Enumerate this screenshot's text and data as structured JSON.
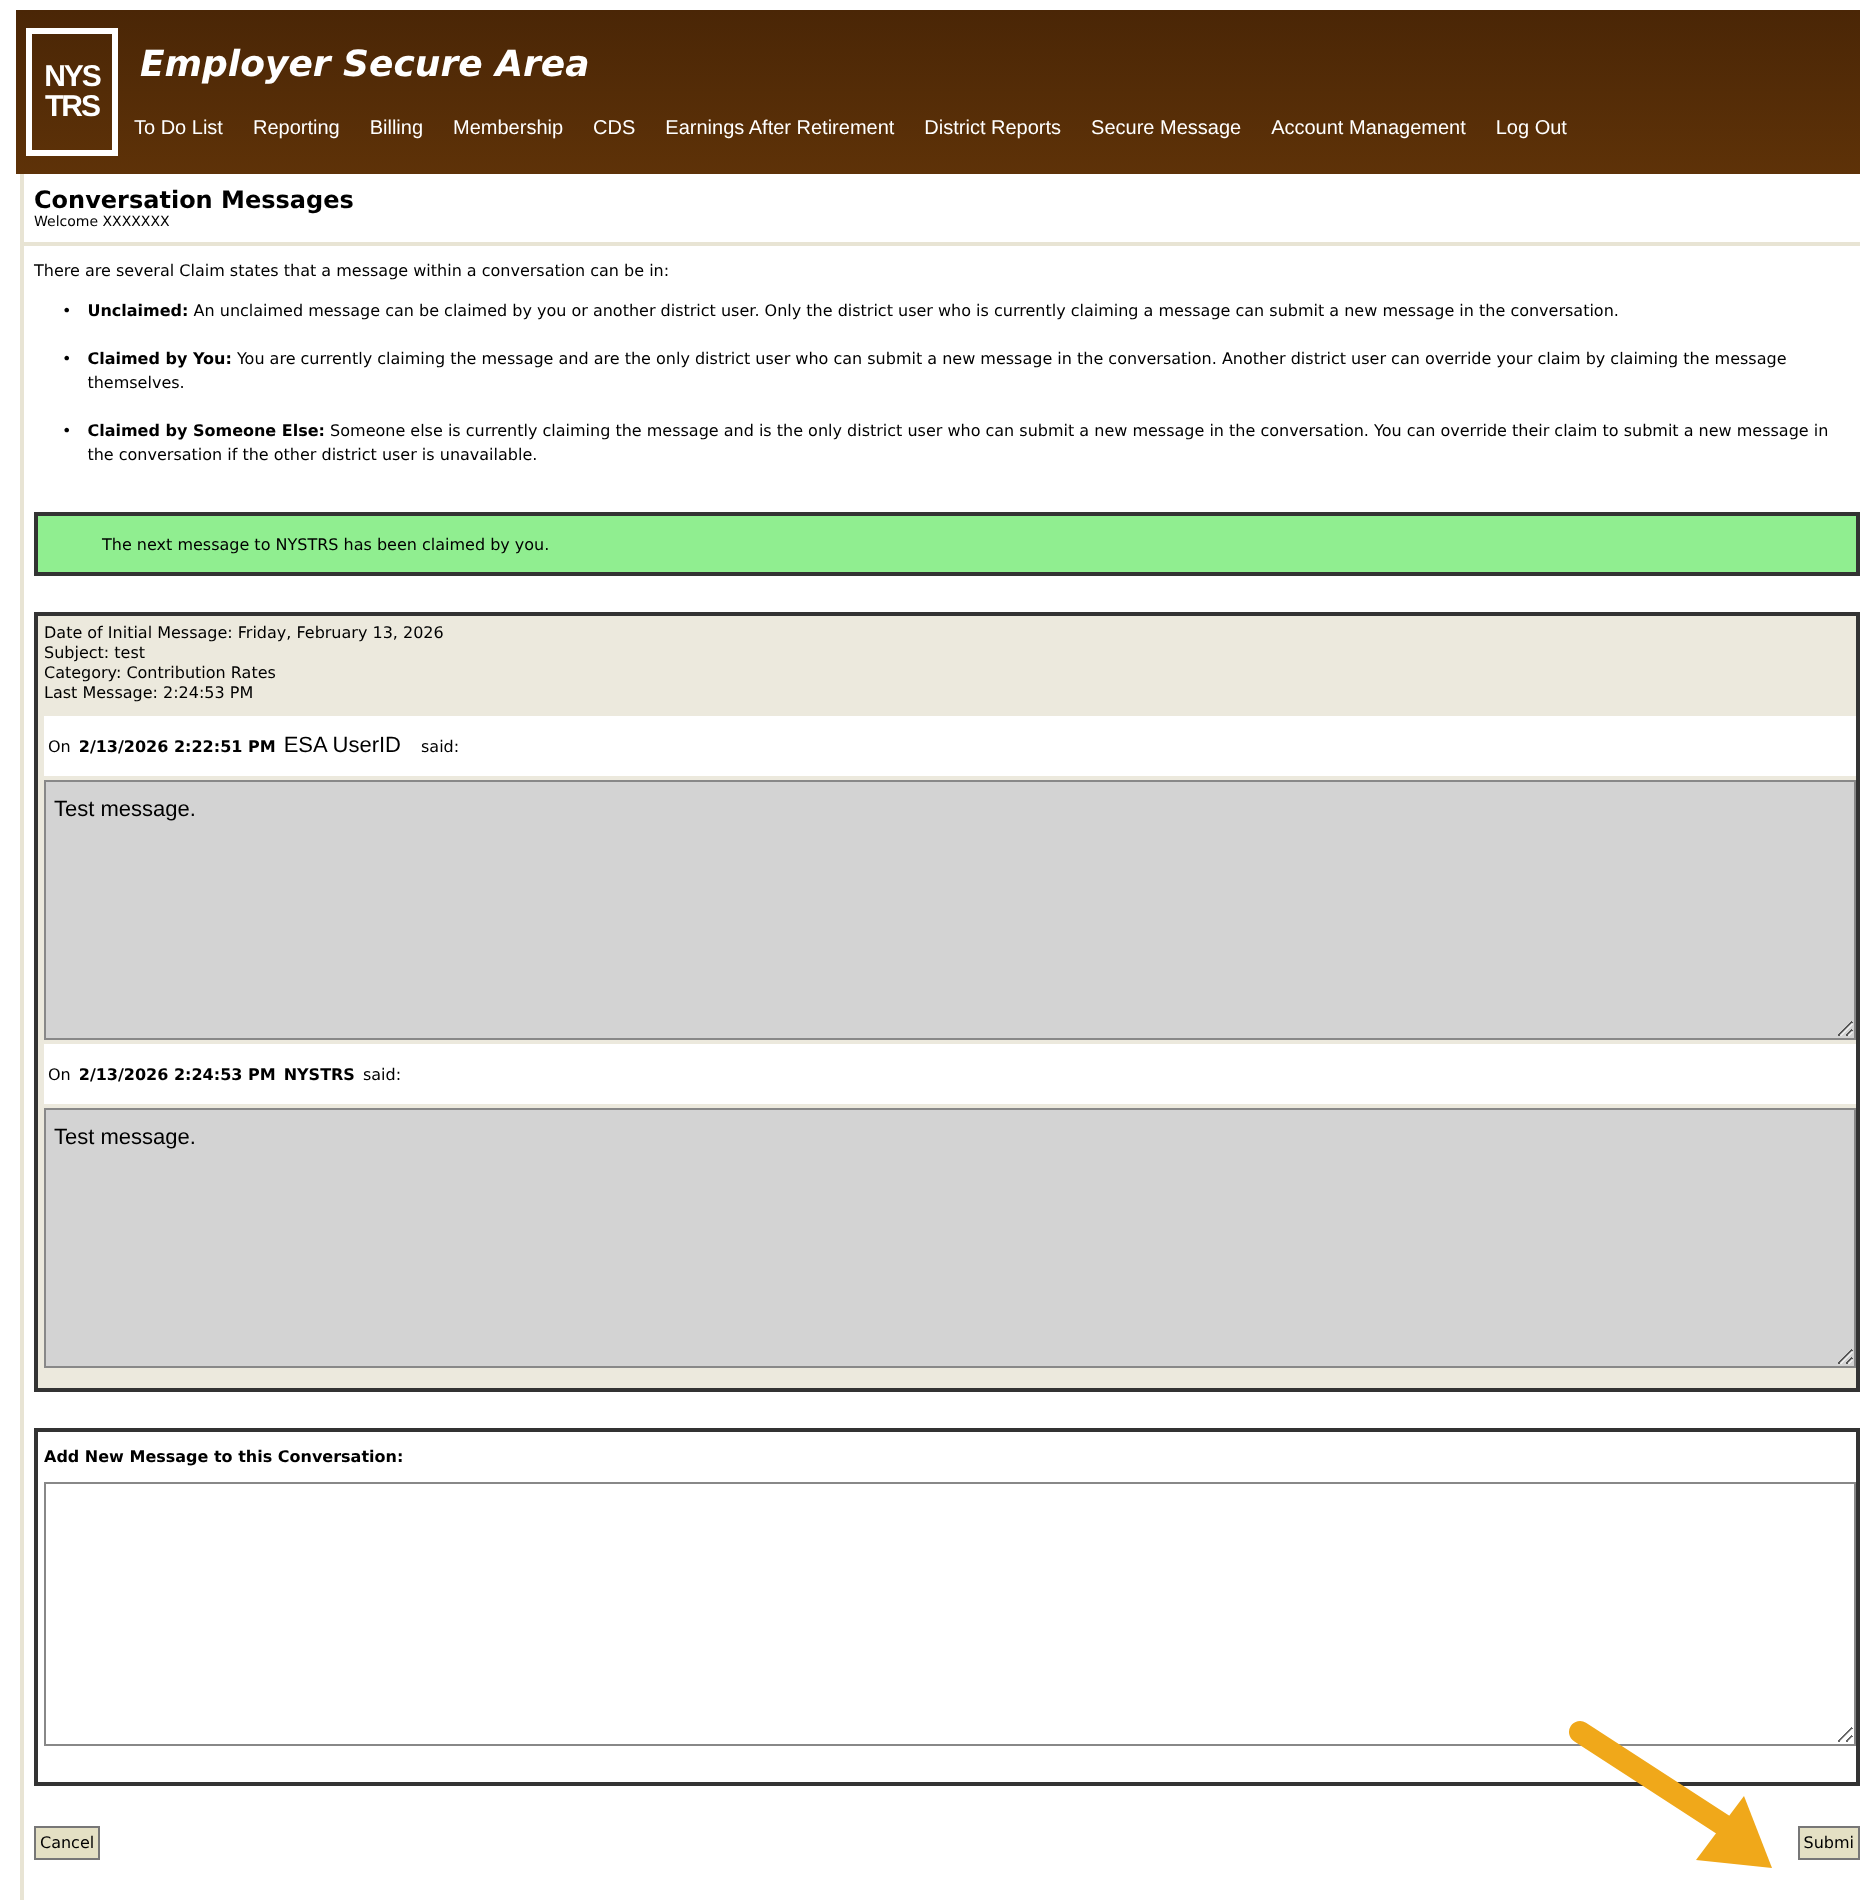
{
  "header": {
    "logo": [
      "NYS",
      "TRS"
    ],
    "title": "Employer Secure Area",
    "nav": [
      "To Do List",
      "Reporting",
      "Billing",
      "Membership",
      "CDS",
      "Earnings After Retirement",
      "District Reports",
      "Secure Message",
      "Account Management",
      "Log Out"
    ]
  },
  "page": {
    "title": "Conversation Messages",
    "welcome": "Welcome XXXXXXX"
  },
  "intro": "There are several Claim states that a message within a conversation can be in:",
  "states": [
    {
      "marker": "•",
      "name": "Unclaimed:",
      "text": "An unclaimed message can be claimed by you or another district user. Only the district user who is currently claiming a message can submit a new message in the conversation."
    },
    {
      "marker": "•",
      "name": "Claimed by You:",
      "text": "You are currently claiming the message and are the only district user who can submit a new message in the conversation. Another district user can override your claim by claiming the message themselves."
    },
    {
      "marker": "•",
      "name": "Claimed by Someone Else:",
      "text": "Someone else is currently claiming the message and is the only district user who can submit a new message in the conversation. You can override their claim to submit a new message in the conversation if the other district user is unavailable."
    }
  ],
  "notice": "The next message to NYSTRS has been claimed by you.",
  "conversation": {
    "details": [
      "Date of Initial Message: Friday, February 13, 2026",
      "Subject: test",
      "Category: Contribution Rates",
      "Last Message: 2:24:53 PM"
    ],
    "messages": [
      {
        "prefix": "On",
        "timestamp": "2/13/2026 2:22:51 PM",
        "author": "ESA UserID",
        "author_bold": false,
        "suffix": "said:",
        "body": "Test message."
      },
      {
        "prefix": "On",
        "timestamp": "2/13/2026 2:24:53 PM",
        "author": "NYSTRS",
        "author_bold": true,
        "suffix": "said:",
        "body": "Test message."
      }
    ]
  },
  "new_message": {
    "label": "Add New Message to this Conversation:"
  },
  "buttons": {
    "cancel": "Cancel",
    "submit": "Submi"
  }
}
